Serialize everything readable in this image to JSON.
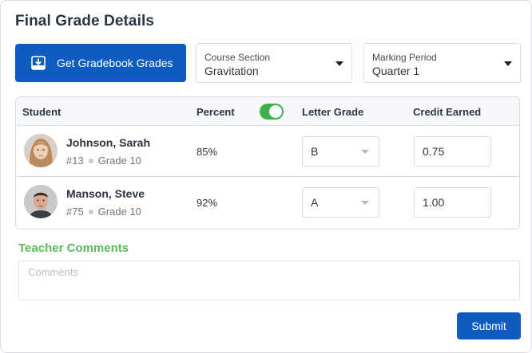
{
  "title": "Final Grade Details",
  "toolbar": {
    "get_grades_label": "Get Gradebook Grades",
    "course_section": {
      "label": "Course Section",
      "value": "Gravitation"
    },
    "marking_period": {
      "label": "Marking Period",
      "value": "Quarter 1"
    }
  },
  "table": {
    "headers": {
      "student": "Student",
      "percent": "Percent",
      "letter_grade": "Letter Grade",
      "credit_earned": "Credit Earned"
    },
    "percent_toggle_on": true,
    "rows": [
      {
        "name": "Johnson, Sarah",
        "id": "#13",
        "grade_level": "Grade 10",
        "percent": "85%",
        "letter_grade": "B",
        "credit": "0.75"
      },
      {
        "name": "Manson, Steve",
        "id": "#75",
        "grade_level": "Grade 10",
        "percent": "92%",
        "letter_grade": "A",
        "credit": "1.00"
      }
    ]
  },
  "comments": {
    "label": "Teacher Comments",
    "placeholder": "Comments",
    "value": ""
  },
  "submit_label": "Submit",
  "colors": {
    "primary": "#0f5cc0",
    "toggle_on": "#3cb04a",
    "comments_label": "#5cb85c"
  }
}
